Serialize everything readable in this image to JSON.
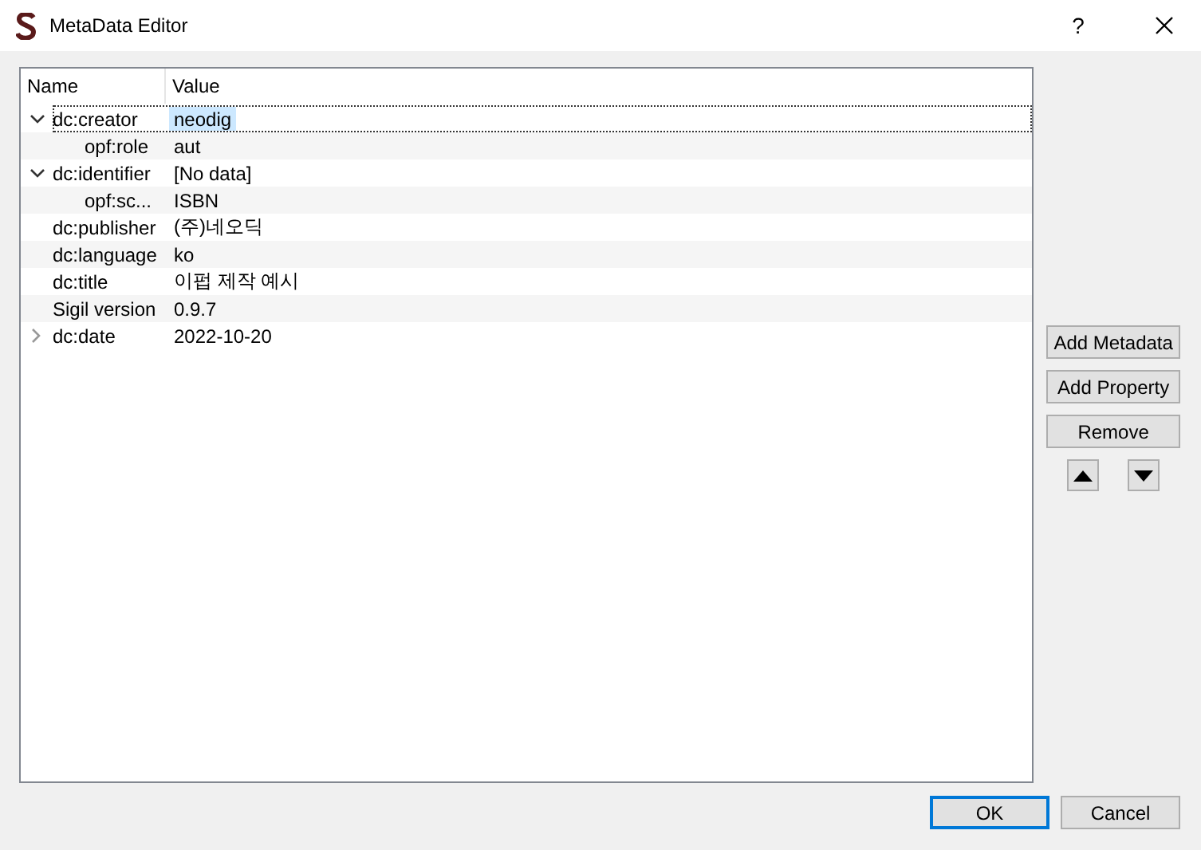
{
  "window": {
    "title": "MetaData Editor",
    "help": "?"
  },
  "tree": {
    "columns": [
      "Name",
      "Value"
    ],
    "rows": [
      {
        "name": "dc:creator",
        "value": "neodig",
        "selected": true,
        "expanded": true,
        "children": [
          {
            "name": "opf:role",
            "value": "aut",
            "selected": false
          }
        ]
      },
      {
        "name": "dc:identifier",
        "value": "[No data]",
        "selected": false,
        "expanded": true,
        "children": [
          {
            "name": "opf:sc...",
            "value": "ISBN",
            "selected": false
          }
        ]
      },
      {
        "name": "dc:publisher",
        "value": "(주)네오딕",
        "selected": false
      },
      {
        "name": "dc:language",
        "value": "ko",
        "selected": false
      },
      {
        "name": "dc:title",
        "value": "이펍 제작 예시",
        "selected": false
      },
      {
        "name": "Sigil version",
        "value": "0.9.7",
        "selected": false
      },
      {
        "name": "dc:date",
        "value": "2022-10-20",
        "selected": false,
        "expanded": false
      }
    ]
  },
  "side_buttons": [
    "Add Metadata",
    "Add Property",
    "Remove"
  ],
  "buttons": [
    {
      "label": "OK",
      "default": true
    },
    {
      "label": "Cancel",
      "default": false
    }
  ]
}
